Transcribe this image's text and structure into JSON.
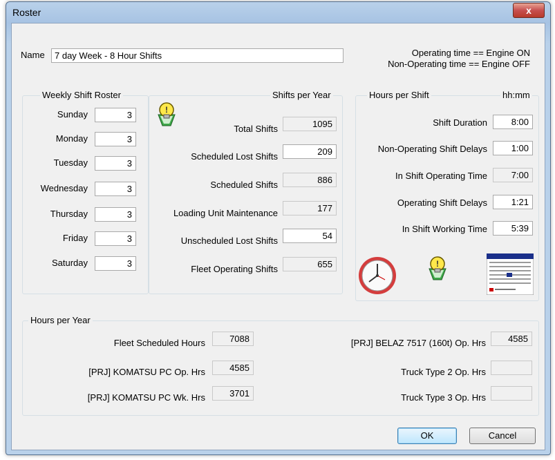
{
  "window": {
    "title": "Roster",
    "close_label": "x"
  },
  "name": {
    "label": "Name",
    "value": "7 day Week - 8 Hour Shifts"
  },
  "notes": {
    "line1": "Operating time == Engine ON",
    "line2": "Non-Operating time == Engine OFF"
  },
  "weekly": {
    "title": "Weekly Shift Roster",
    "days": [
      {
        "label": "Sunday",
        "value": "3"
      },
      {
        "label": "Monday",
        "value": "3"
      },
      {
        "label": "Tuesday",
        "value": "3"
      },
      {
        "label": "Wednesday",
        "value": "3"
      },
      {
        "label": "Thursday",
        "value": "3"
      },
      {
        "label": "Friday",
        "value": "3"
      },
      {
        "label": "Saturday",
        "value": "3"
      }
    ]
  },
  "shifts": {
    "title": "Shifts per Year",
    "rows": [
      {
        "label": "Total Shifts",
        "value": "1095"
      },
      {
        "label": "Scheduled Lost Shifts",
        "value": "209"
      },
      {
        "label": "Scheduled Shifts",
        "value": "886"
      },
      {
        "label": "Loading Unit Maintenance",
        "value": "177"
      },
      {
        "label": "Unscheduled Lost Shifts",
        "value": "54"
      },
      {
        "label": "Fleet Operating Shifts",
        "value": "655"
      }
    ]
  },
  "hours_shift": {
    "title": "Hours per Shift",
    "unit": "hh:mm",
    "rows": [
      {
        "label": "Shift Duration",
        "value": "8:00"
      },
      {
        "label": "Non-Operating Shift Delays",
        "value": "1:00"
      },
      {
        "label": "In Shift Operating Time",
        "value": "7:00"
      },
      {
        "label": "Operating Shift Delays",
        "value": "1:21"
      },
      {
        "label": "In Shift Working Time",
        "value": "5:39"
      }
    ]
  },
  "hours_year": {
    "title": "Hours per Year",
    "left": [
      {
        "label": "Fleet Scheduled Hours",
        "value": "7088"
      },
      {
        "label": "[PRJ] KOMATSU PC  Op. Hrs",
        "value": "4585"
      },
      {
        "label": "[PRJ] KOMATSU PC Wk. Hrs",
        "value": "3701"
      }
    ],
    "right": [
      {
        "label": "[PRJ] BELAZ 7517 (160t)  Op. Hrs",
        "value": "4585"
      },
      {
        "label": "Truck Type 2  Op. Hrs",
        "value": ""
      },
      {
        "label": "Truck Type 3  Op. Hrs",
        "value": ""
      }
    ]
  },
  "buttons": {
    "ok": "OK",
    "cancel": "Cancel"
  },
  "icons": [
    "lightbulb-icon",
    "clock-icon",
    "calendar-icon"
  ]
}
